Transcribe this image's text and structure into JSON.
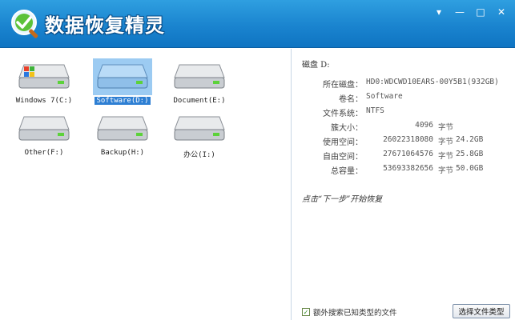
{
  "window": {
    "title": "数据恢复精灵",
    "controls": [
      "▾",
      "—",
      "□",
      "✕"
    ]
  },
  "drives": [
    {
      "label": "Windows 7(C:)",
      "selected": false,
      "windows_logo": true
    },
    {
      "label": "Software(D:)",
      "selected": true,
      "windows_logo": false
    },
    {
      "label": "Document(E:)",
      "selected": false,
      "windows_logo": false
    },
    {
      "label": "Other(F:)",
      "selected": false,
      "windows_logo": false
    },
    {
      "label": "Backup(H:)",
      "selected": false,
      "windows_logo": false
    },
    {
      "label": "办公(I:)",
      "selected": false,
      "windows_logo": false
    }
  ],
  "info": {
    "heading": "磁盘 D:",
    "disk_label": "所在磁盘：",
    "disk_value": "HD0:WDCWD10EARS-00Y5B1(932GB)",
    "volume_label": "卷名：",
    "volume_value": "Software",
    "fs_label": "文件系统：",
    "fs_value": "NTFS",
    "cluster_label": "簇大小：",
    "cluster_bytes": "4096",
    "cluster_unit": "字节",
    "used_label": "使用空间：",
    "used_bytes": "26022318080",
    "used_unit": "字节",
    "used_size": "24.2GB",
    "free_label": "自由空间：",
    "free_bytes": "27671064576",
    "free_unit": "字节",
    "free_size": "25.8GB",
    "total_label": "总容量：",
    "total_bytes": "53693382656",
    "total_unit": "字节",
    "total_size": "50.0GB"
  },
  "hint": "点击“下一步”开始恢复",
  "options": {
    "extra_search_label": "额外搜索已知类型的文件",
    "extra_search_checked": true,
    "choose_types_button": "选择文件类型"
  },
  "colors": {
    "titlebar": "#1a84cf",
    "selection": "#2e7fd3"
  }
}
